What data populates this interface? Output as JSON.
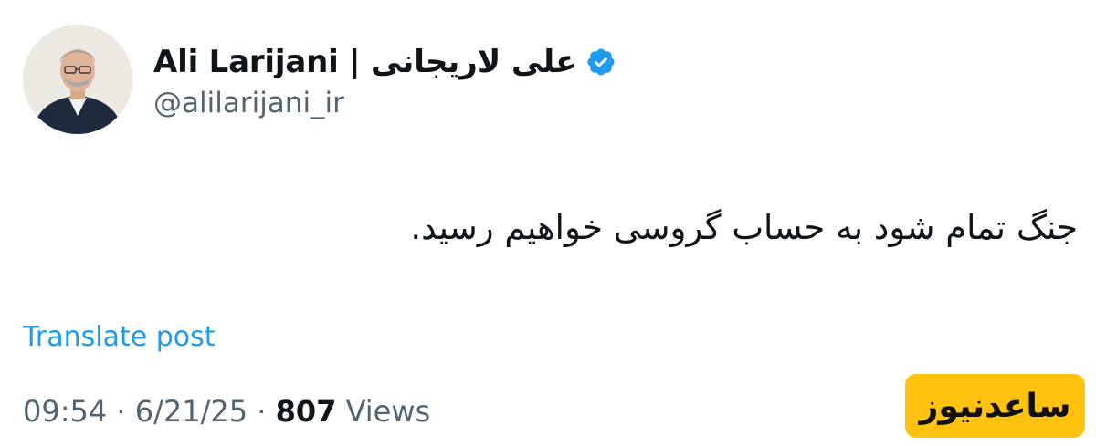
{
  "author": {
    "display_name": "Ali Larijani | علی لاریجانی",
    "handle": "@alilarijani_ir",
    "verified_icon": "verified-badge-icon",
    "avatar": "profile-photo"
  },
  "post": {
    "text": "جنگ تمام شود به حساب گروسی خواهیم رسید.",
    "translate_label": "Translate post"
  },
  "meta": {
    "time": "09:54",
    "separator": "·",
    "date": "6/21/25",
    "views_count": "807",
    "views_label": "Views"
  },
  "watermark": {
    "text": "ساعدنیوز",
    "bg_color": "#ffc20e"
  },
  "colors": {
    "link": "#1d9bf0",
    "secondary_text": "#536471",
    "primary_text": "#0f1419",
    "verified": "#1d9bf0"
  }
}
